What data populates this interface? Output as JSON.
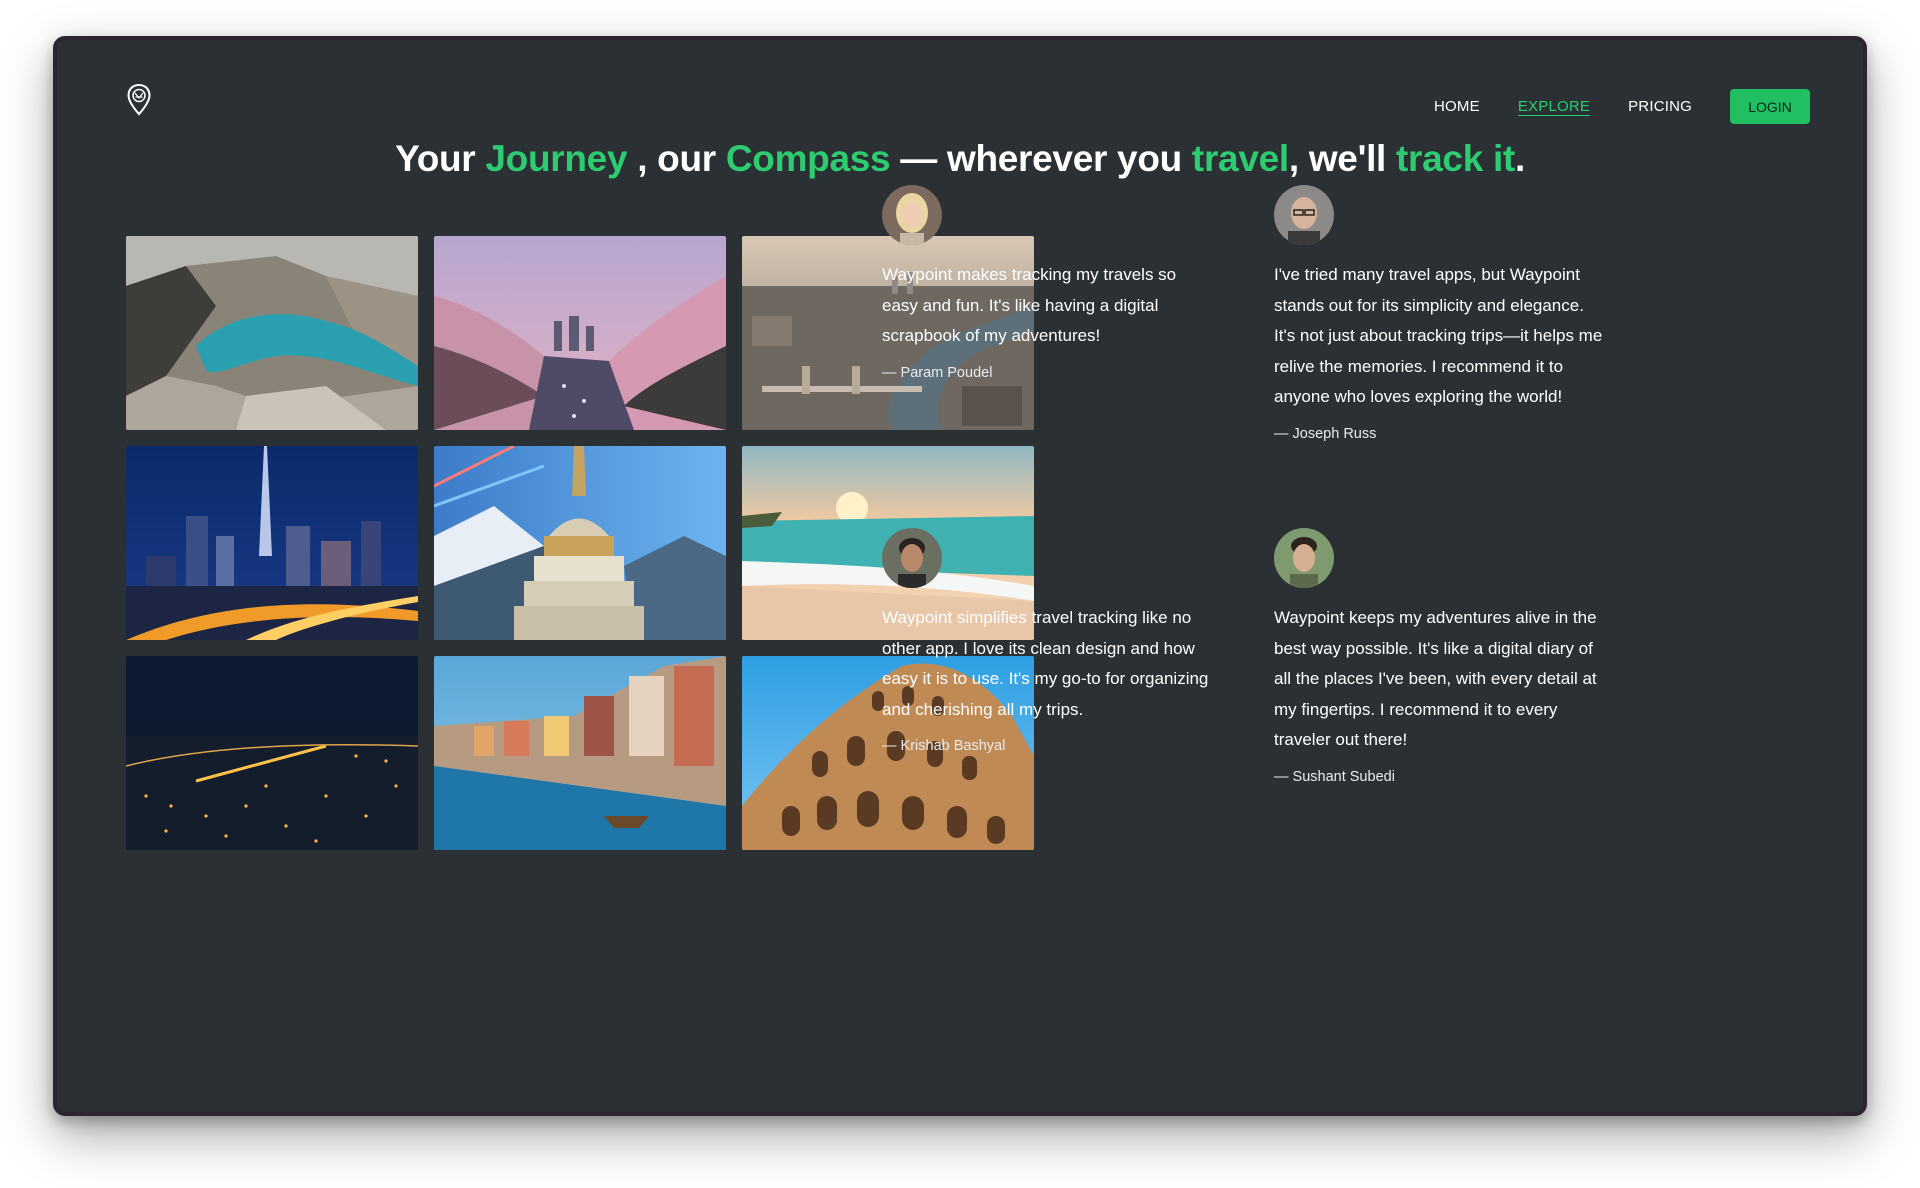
{
  "nav": {
    "links": [
      "HOME",
      "EXPLORE",
      "PRICING"
    ],
    "active": "EXPLORE",
    "login": "LOGIN"
  },
  "headline": {
    "p1": "Your ",
    "h1": "Journey",
    "p2": " , our ",
    "h2": "Compass",
    "p3": " — wherever you ",
    "h3": "travel",
    "p4": ", we'll ",
    "h4": "track it",
    "p5": "."
  },
  "colors": {
    "background": "#2a3034",
    "accent": "#2ecc71",
    "button": "#1fbf62",
    "text": "#ffffff"
  },
  "gallery": [
    {
      "name": "mountain-lake-photo"
    },
    {
      "name": "cherry-blossom-river-photo"
    },
    {
      "name": "london-aerial-photo"
    },
    {
      "name": "dubai-night-skyline-photo"
    },
    {
      "name": "stupa-mountains-photo"
    },
    {
      "name": "beach-sunset-photo"
    },
    {
      "name": "night-city-bridge-photo"
    },
    {
      "name": "porto-riverside-photo"
    },
    {
      "name": "colosseum-photo"
    }
  ],
  "testimonials": [
    {
      "quote": "Waypoint makes tracking my travels so easy and fun. It's like having a digital scrapbook of my adventures!",
      "author": "— Param Poudel"
    },
    {
      "quote": "I've tried many travel apps, but Waypoint stands out for its simplicity and elegance. It's not just about tracking trips—it helps me relive the memories. I recommend it to anyone who loves exploring the world!",
      "author": "— Joseph Russ"
    },
    {
      "quote": "Waypoint simplifies travel tracking like no other app. I love its clean design and how easy it is to use. It's my go-to for organizing and cherishing all my trips.",
      "author": "— Krishab Bashyal"
    },
    {
      "quote": "Waypoint keeps my adventures alive in the best way possible. It's like a digital diary of all the places I've been, with every detail at my fingertips. I recommend it to every traveler out there!",
      "author": "— Sushant Subedi"
    }
  ]
}
